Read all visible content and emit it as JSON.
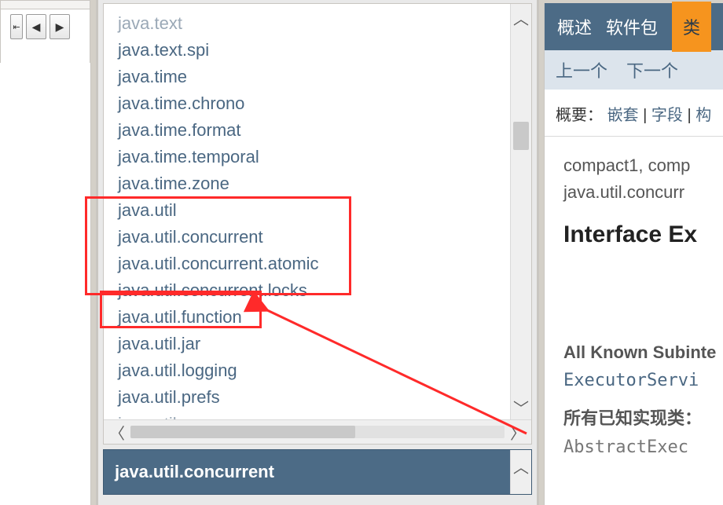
{
  "toolbar": {
    "collapse_glyph": "⇤",
    "prev_glyph": "◀",
    "next_glyph": "▶"
  },
  "packages": [
    {
      "name": "java.text",
      "cut": true
    },
    {
      "name": "java.text.spi"
    },
    {
      "name": "java.time"
    },
    {
      "name": "java.time.chrono"
    },
    {
      "name": "java.time.format"
    },
    {
      "name": "java.time.temporal"
    },
    {
      "name": "java.time.zone"
    },
    {
      "name": "java.util"
    },
    {
      "name": "java.util.concurrent"
    },
    {
      "name": "java.util.concurrent.atomic"
    },
    {
      "name": "java.util.concurrent.locks"
    },
    {
      "name": "java.util.function"
    },
    {
      "name": "java.util.jar"
    },
    {
      "name": "java.util.logging"
    },
    {
      "name": "java.util.prefs"
    },
    {
      "name": "java.util.regex",
      "cut": true
    }
  ],
  "selected_package": "java.util.concurrent",
  "doc": {
    "tab_overview": "概述",
    "tab_package": "软件包",
    "tab_class": "类",
    "nav_prev": "上一个",
    "nav_next": "下一个",
    "summary_label": "概要：",
    "summary_nested": "嵌套",
    "summary_field": "字段",
    "summary_rest": "构",
    "profiles": "compact1, comp",
    "pkg_line": "java.util.concurr",
    "iface_title": "Interface Ex",
    "subiface_hdr": "All Known Subinte",
    "subiface_link": "ExecutorServi",
    "impl_hdr": "所有已知实现类：",
    "impl_link": "AbstractExec"
  },
  "glyphs": {
    "up": "︿",
    "down": "﹀",
    "left": "〈",
    "right": "〉"
  }
}
